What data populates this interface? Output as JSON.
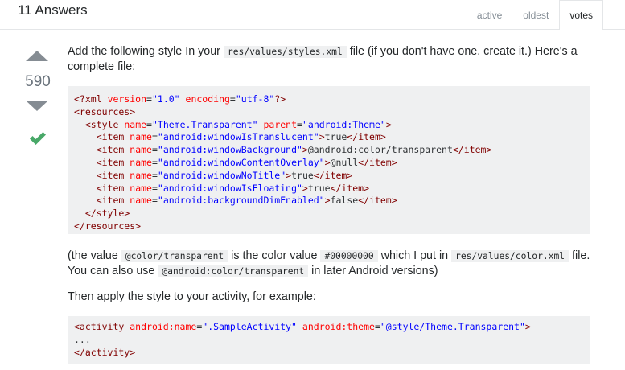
{
  "header": {
    "title": "11 Answers",
    "tabs": [
      {
        "label": "active",
        "selected": false
      },
      {
        "label": "oldest",
        "selected": false
      },
      {
        "label": "votes",
        "selected": true
      }
    ]
  },
  "vote": {
    "count": "590",
    "accepted": true
  },
  "answer": {
    "p1": {
      "t1": "Add the following style In your ",
      "c1": "res/values/styles.xml",
      "t2": " file (if you don't have one, create it.) Here's a complete file:"
    },
    "code1": [
      {
        "t": "<?xml version=\"1.0\" encoding=\"utf-8\"?>"
      },
      {
        "t": "<resources>"
      },
      {
        "t": "  <style name=\"Theme.Transparent\" parent=\"android:Theme\">"
      },
      {
        "t": "    <item name=\"android:windowIsTranslucent\">true</item>"
      },
      {
        "t": "    <item name=\"android:windowBackground\">@android:color/transparent</item>"
      },
      {
        "t": "    <item name=\"android:windowContentOverlay\">@null</item>"
      },
      {
        "t": "    <item name=\"android:windowNoTitle\">true</item>"
      },
      {
        "t": "    <item name=\"android:windowIsFloating\">true</item>"
      },
      {
        "t": "    <item name=\"android:backgroundDimEnabled\">false</item>"
      },
      {
        "t": "  </style>"
      },
      {
        "t": "</resources>"
      }
    ],
    "p2": {
      "t1": "(the value ",
      "c1": "@color/transparent",
      "t2": " is the color value ",
      "c2": "#00000000",
      "t3": " which I put in ",
      "c3": "res/values/color.xml",
      "t4": " file. You can also use ",
      "c4": "@android:color/transparent",
      "t5": " in later Android versions)"
    },
    "p3": "Then apply the style to your activity, for example:",
    "code2": [
      {
        "t": "<activity android:name=\".SampleActivity\" android:theme=\"@style/Theme.Transparent\">"
      },
      {
        "t": "..."
      },
      {
        "t": "</activity>"
      }
    ]
  },
  "colors": {
    "tag": "#800000",
    "attr": "#ff0000",
    "value": "#0000ff",
    "accepted_check": "#48a868",
    "vote_arrow": "#858c93"
  }
}
